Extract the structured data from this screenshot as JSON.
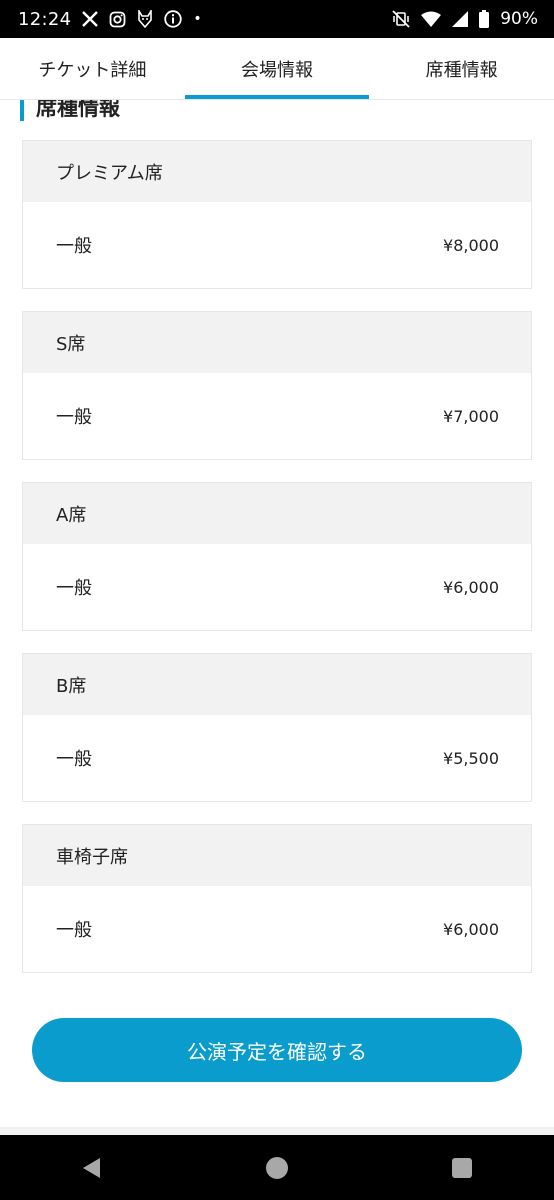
{
  "status_bar": {
    "time": "12:24",
    "battery": "90%",
    "dot": "•",
    "icons_left": [
      "x-logo-icon",
      "instagram-icon",
      "fox-app-icon",
      "info-icon"
    ],
    "icons_right": [
      "vibrate-off-icon",
      "wifi-icon",
      "signal-icon",
      "battery-icon"
    ]
  },
  "tabs": [
    {
      "label": "チケット詳細",
      "active": false
    },
    {
      "label": "会場情報",
      "active": true
    },
    {
      "label": "席種情報",
      "active": false
    }
  ],
  "section": {
    "title": "席種情報"
  },
  "seats": [
    {
      "name": "プレミアム席",
      "type": "一般",
      "price": "¥8,000"
    },
    {
      "name": "S席",
      "type": "一般",
      "price": "¥7,000"
    },
    {
      "name": "A席",
      "type": "一般",
      "price": "¥6,000"
    },
    {
      "name": "B席",
      "type": "一般",
      "price": "¥5,500"
    },
    {
      "name": "車椅子席",
      "type": "一般",
      "price": "¥6,000"
    }
  ],
  "confirm_button": {
    "label": "公演予定を確認する"
  },
  "colors": {
    "accent": "#0a9ccc",
    "card_header": "#f2f2f2"
  }
}
